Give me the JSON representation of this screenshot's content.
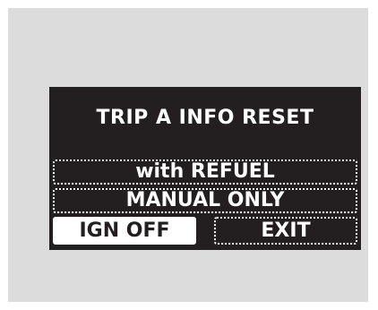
{
  "screen": {
    "title": "TRIP A INFO RESET",
    "options": [
      {
        "label": "with REFUEL",
        "selected": false
      },
      {
        "label": "MANUAL ONLY",
        "selected": false
      },
      {
        "label": "IGN OFF",
        "selected": true
      },
      {
        "label": "EXIT",
        "selected": false
      }
    ]
  },
  "colors": {
    "background_panel": "#dcdcdd",
    "display_bg": "#231f20",
    "display_text": "#ffffff",
    "selected_bg": "#ffffff",
    "selected_text": "#231f20"
  }
}
